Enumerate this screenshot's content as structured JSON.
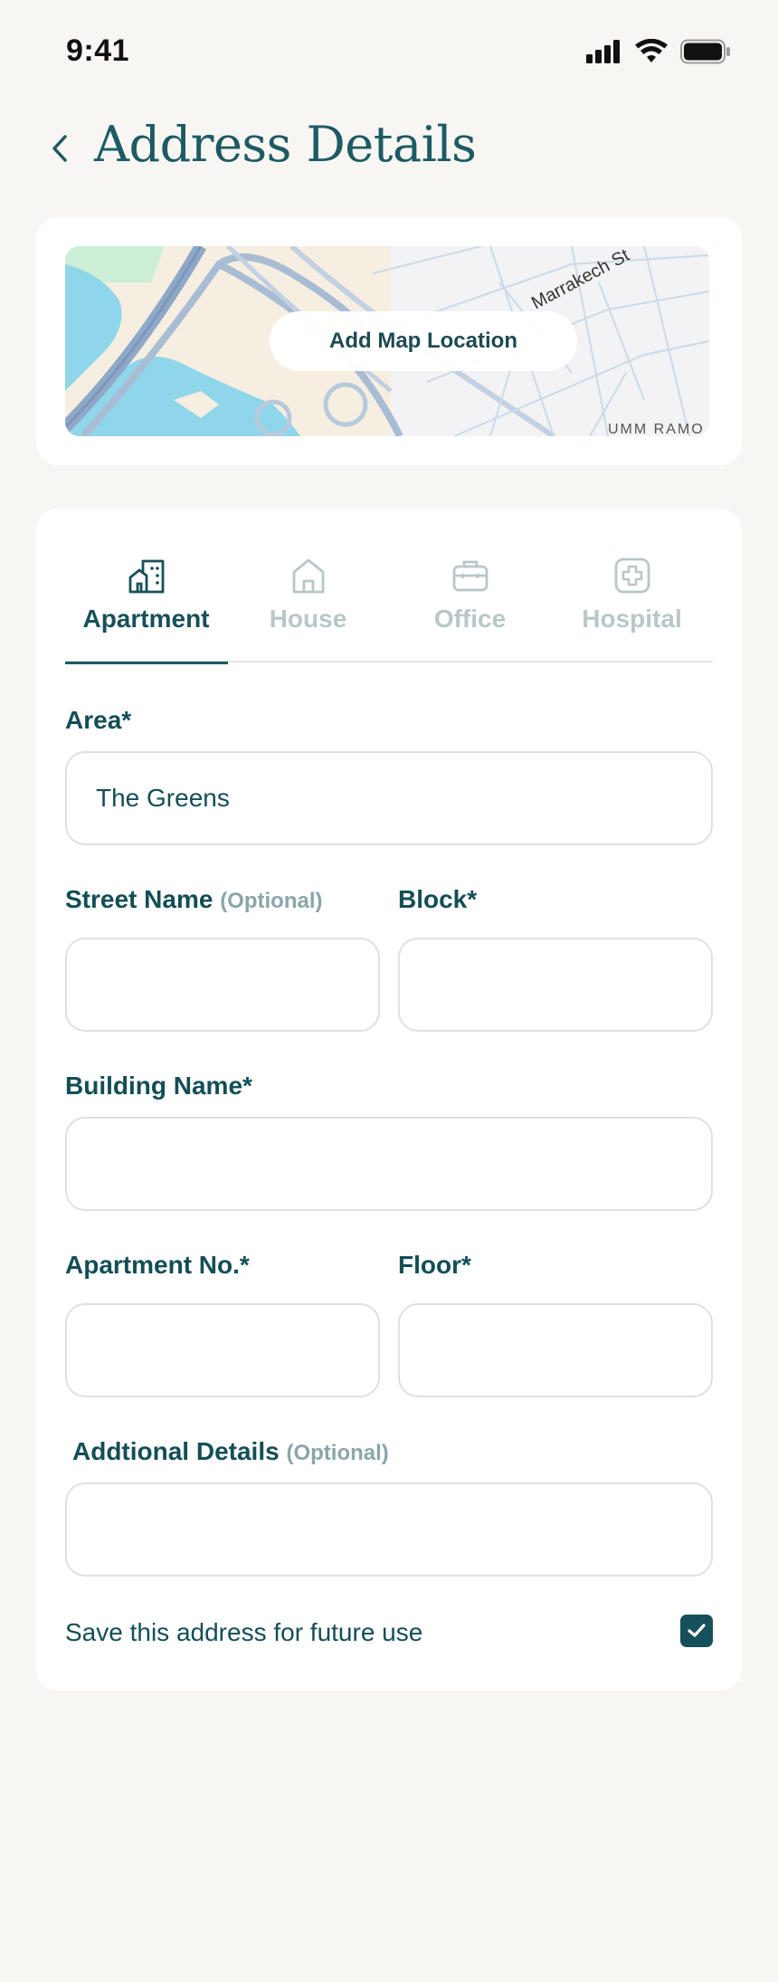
{
  "status_bar": {
    "time": "9:41",
    "icons": [
      "signal-icon",
      "wifi-icon",
      "battery-icon"
    ]
  },
  "header": {
    "back_icon": "chevron-left-icon",
    "title": "Address Details"
  },
  "map": {
    "button_label": "Add Map Location",
    "street_label": "Marrakech St",
    "district_label": "UMM RAMO"
  },
  "tabs": [
    {
      "label": "Apartment",
      "icon": "apartment-icon",
      "active": true
    },
    {
      "label": "House",
      "icon": "house-icon",
      "active": false
    },
    {
      "label": "Office",
      "icon": "briefcase-icon",
      "active": false
    },
    {
      "label": "Hospital",
      "icon": "hospital-icon",
      "active": false
    }
  ],
  "form": {
    "area": {
      "label": "Area*",
      "value": "The Greens"
    },
    "street": {
      "label": "Street Name",
      "optional": "(Optional)",
      "value": ""
    },
    "block": {
      "label": "Block*",
      "value": ""
    },
    "building": {
      "label": "Building Name*",
      "value": ""
    },
    "apartment_no": {
      "label": "Apartment No.*",
      "value": ""
    },
    "floor": {
      "label": "Floor*",
      "value": ""
    },
    "additional": {
      "label": "Addtional Details",
      "optional": "(Optional)",
      "value": ""
    },
    "save": {
      "label": "Save this address for future use",
      "checked": true
    }
  },
  "colors": {
    "accent": "#16505a",
    "inactive_tab": "#b9c7c9",
    "background": "#f7f6f3",
    "optional_text": "#8aa6aa"
  }
}
